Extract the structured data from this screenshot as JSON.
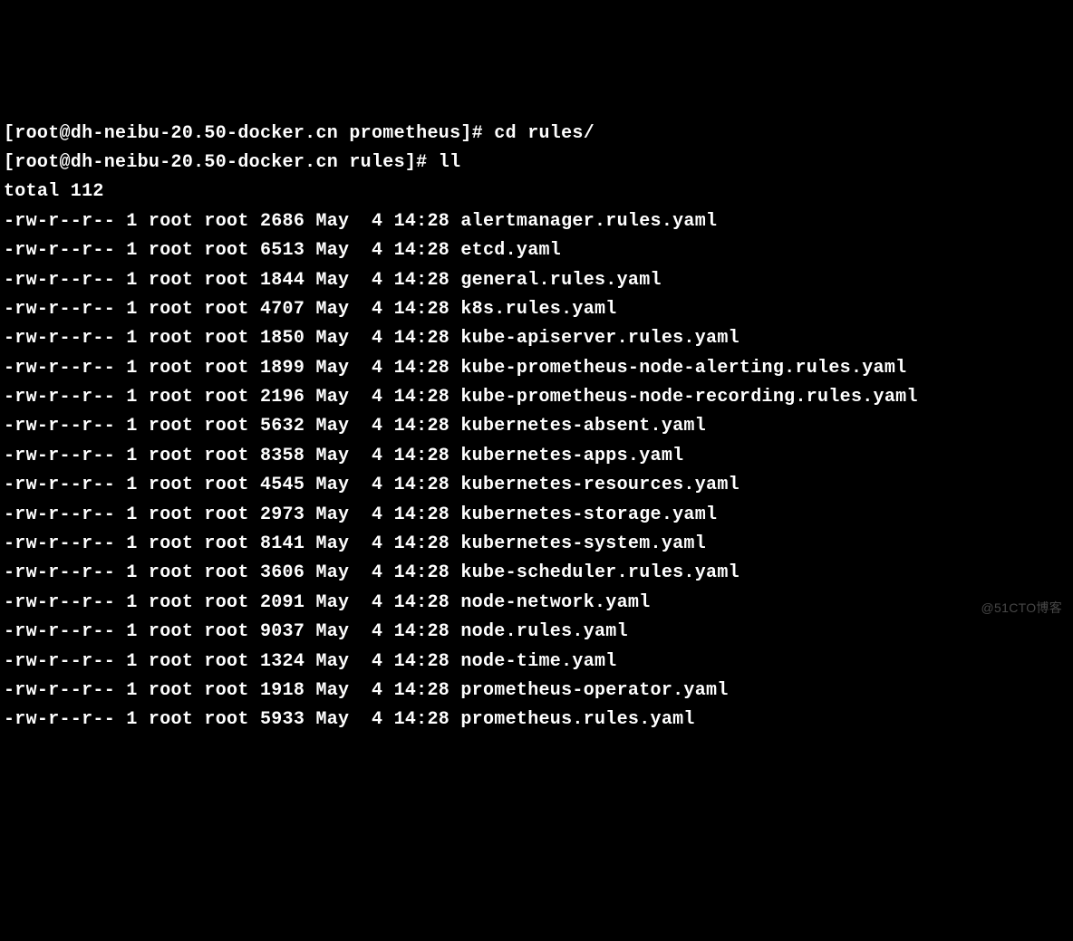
{
  "prompt1": {
    "full": "[root@dh-neibu-20.50-docker.cn prometheus]# cd rules/"
  },
  "prompt2": {
    "full": "[root@dh-neibu-20.50-docker.cn rules]# ll"
  },
  "total_line": "total 112",
  "files": [
    {
      "perms": "-rw-r--r--",
      "links": "1",
      "owner": "root",
      "group": "root",
      "size": "2686",
      "month": "May",
      "day": " 4",
      "time": "14:28",
      "name": "alertmanager.rules.yaml"
    },
    {
      "perms": "-rw-r--r--",
      "links": "1",
      "owner": "root",
      "group": "root",
      "size": "6513",
      "month": "May",
      "day": " 4",
      "time": "14:28",
      "name": "etcd.yaml"
    },
    {
      "perms": "-rw-r--r--",
      "links": "1",
      "owner": "root",
      "group": "root",
      "size": "1844",
      "month": "May",
      "day": " 4",
      "time": "14:28",
      "name": "general.rules.yaml"
    },
    {
      "perms": "-rw-r--r--",
      "links": "1",
      "owner": "root",
      "group": "root",
      "size": "4707",
      "month": "May",
      "day": " 4",
      "time": "14:28",
      "name": "k8s.rules.yaml"
    },
    {
      "perms": "-rw-r--r--",
      "links": "1",
      "owner": "root",
      "group": "root",
      "size": "1850",
      "month": "May",
      "day": " 4",
      "time": "14:28",
      "name": "kube-apiserver.rules.yaml"
    },
    {
      "perms": "-rw-r--r--",
      "links": "1",
      "owner": "root",
      "group": "root",
      "size": "1899",
      "month": "May",
      "day": " 4",
      "time": "14:28",
      "name": "kube-prometheus-node-alerting.rules.yaml"
    },
    {
      "perms": "-rw-r--r--",
      "links": "1",
      "owner": "root",
      "group": "root",
      "size": "2196",
      "month": "May",
      "day": " 4",
      "time": "14:28",
      "name": "kube-prometheus-node-recording.rules.yaml"
    },
    {
      "perms": "-rw-r--r--",
      "links": "1",
      "owner": "root",
      "group": "root",
      "size": "5632",
      "month": "May",
      "day": " 4",
      "time": "14:28",
      "name": "kubernetes-absent.yaml"
    },
    {
      "perms": "-rw-r--r--",
      "links": "1",
      "owner": "root",
      "group": "root",
      "size": "8358",
      "month": "May",
      "day": " 4",
      "time": "14:28",
      "name": "kubernetes-apps.yaml"
    },
    {
      "perms": "-rw-r--r--",
      "links": "1",
      "owner": "root",
      "group": "root",
      "size": "4545",
      "month": "May",
      "day": " 4",
      "time": "14:28",
      "name": "kubernetes-resources.yaml"
    },
    {
      "perms": "-rw-r--r--",
      "links": "1",
      "owner": "root",
      "group": "root",
      "size": "2973",
      "month": "May",
      "day": " 4",
      "time": "14:28",
      "name": "kubernetes-storage.yaml"
    },
    {
      "perms": "-rw-r--r--",
      "links": "1",
      "owner": "root",
      "group": "root",
      "size": "8141",
      "month": "May",
      "day": " 4",
      "time": "14:28",
      "name": "kubernetes-system.yaml"
    },
    {
      "perms": "-rw-r--r--",
      "links": "1",
      "owner": "root",
      "group": "root",
      "size": "3606",
      "month": "May",
      "day": " 4",
      "time": "14:28",
      "name": "kube-scheduler.rules.yaml"
    },
    {
      "perms": "-rw-r--r--",
      "links": "1",
      "owner": "root",
      "group": "root",
      "size": "2091",
      "month": "May",
      "day": " 4",
      "time": "14:28",
      "name": "node-network.yaml"
    },
    {
      "perms": "-rw-r--r--",
      "links": "1",
      "owner": "root",
      "group": "root",
      "size": "9037",
      "month": "May",
      "day": " 4",
      "time": "14:28",
      "name": "node.rules.yaml"
    },
    {
      "perms": "-rw-r--r--",
      "links": "1",
      "owner": "root",
      "group": "root",
      "size": "1324",
      "month": "May",
      "day": " 4",
      "time": "14:28",
      "name": "node-time.yaml"
    },
    {
      "perms": "-rw-r--r--",
      "links": "1",
      "owner": "root",
      "group": "root",
      "size": "1918",
      "month": "May",
      "day": " 4",
      "time": "14:28",
      "name": "prometheus-operator.yaml"
    },
    {
      "perms": "-rw-r--r--",
      "links": "1",
      "owner": "root",
      "group": "root",
      "size": "5933",
      "month": "May",
      "day": " 4",
      "time": "14:28",
      "name": "prometheus.rules.yaml"
    }
  ],
  "watermark": "@51CTO博客"
}
